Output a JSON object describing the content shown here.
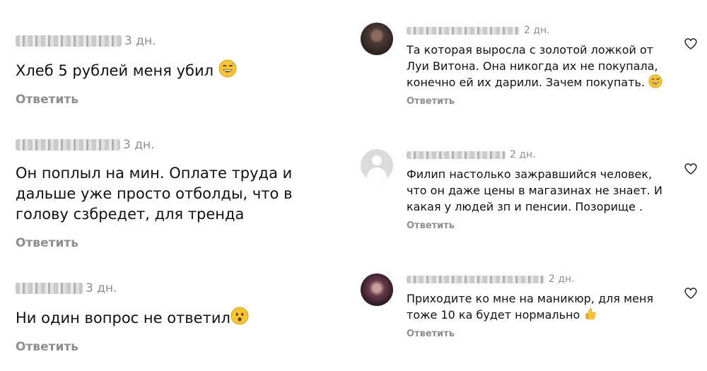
{
  "left": {
    "comments": [
      {
        "username": "shumilov.1981",
        "time": "3 дн.",
        "text": "Хлеб  5 рублей меня убил",
        "emoji": "grinning-sweat-emoji",
        "reply": "Ответить"
      },
      {
        "username": "ellionora_1981",
        "time": "3 дн.",
        "text": "Он поплыл на мин. Оплате труда и дальше уже просто отболды, что в голову сзбредет, для тренда",
        "reply": "Ответить"
      },
      {
        "username": "l",
        "time": "3 дн.",
        "text": "Ни один вопрос не ответил",
        "emoji": "astonished-face-emoji",
        "reply": "Ответить"
      }
    ]
  },
  "right": {
    "comments": [
      {
        "avatar": "profile-photo",
        "time": "2 дн.",
        "text": "Та которая выросла с золотой ложкой от Луи Витона. Она никогда их не покупала, конечно ей их дарили. Зачем покупать.",
        "emoji": "grinning-sweat-emoji",
        "reply": "Ответить"
      },
      {
        "avatar": "default-avatar",
        "time": "2 дн.",
        "text": "Филип настолько зажравшийся человек, что он даже цены в магазинах не знает. И какая у людей зп и пенсии. Позорище .",
        "reply": "Ответить"
      },
      {
        "avatar": "profile-photo",
        "time": "2 дн.",
        "text": "Приходите ко мне на маникюр, для меня тоже 10 ка будет нормально",
        "emoji": "thumbs-up-emoji",
        "reply": "Ответить"
      }
    ]
  },
  "icons": {
    "like": "heart-outline-icon"
  },
  "colors": {
    "secondary_text": "#8e8e8e",
    "primary_text": "#111111",
    "background": "#ffffff"
  }
}
